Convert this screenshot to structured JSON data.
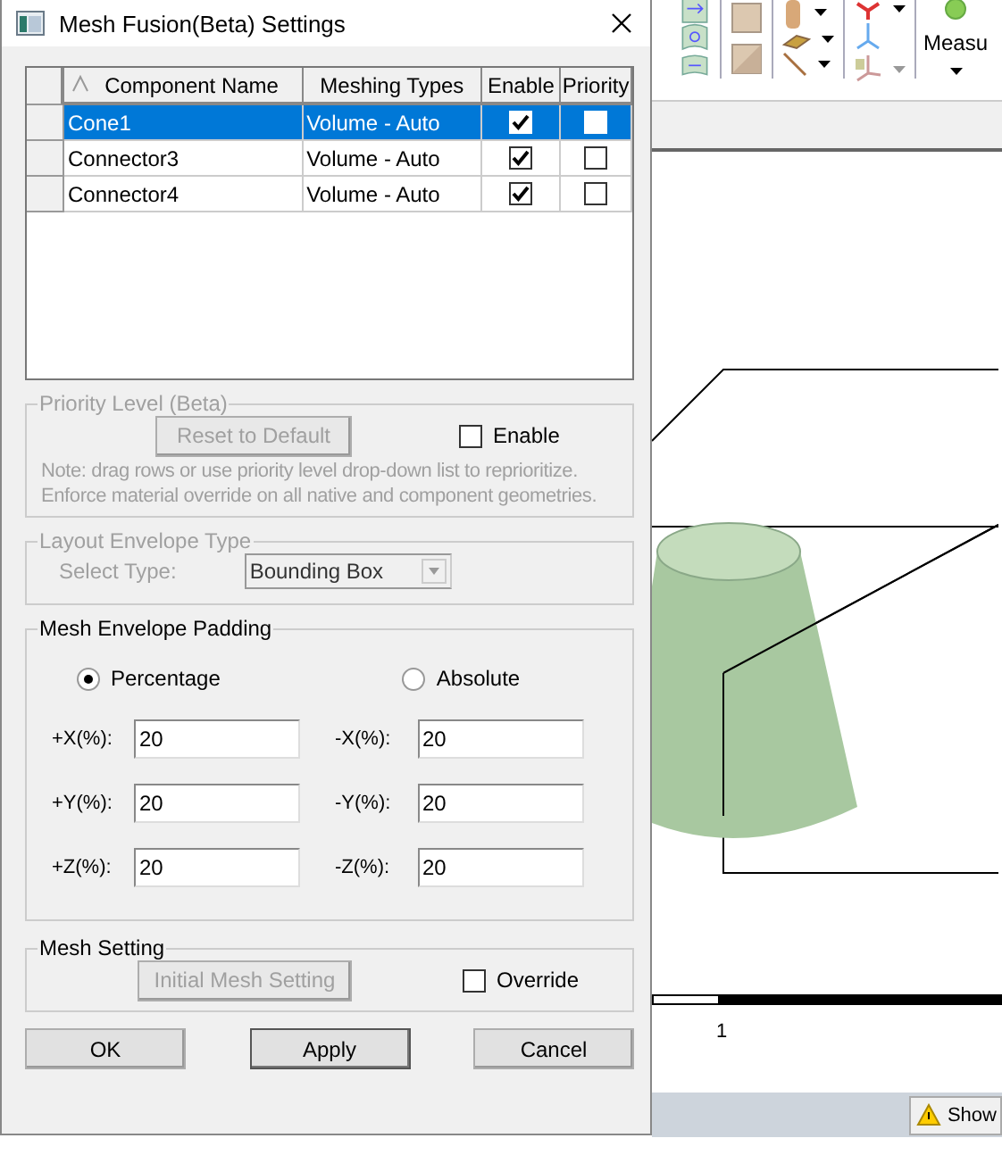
{
  "window": {
    "title": "Mesh Fusion(Beta) Settings"
  },
  "table": {
    "columns": [
      "Component Name",
      "Meshing Types",
      "Enable",
      "Priority"
    ],
    "rows": [
      {
        "name": "Cone1",
        "meshing_type": "Volume - Auto",
        "enable": true,
        "priority": false,
        "selected": true
      },
      {
        "name": "Connector3",
        "meshing_type": "Volume - Auto",
        "enable": true,
        "priority": false,
        "selected": false
      },
      {
        "name": "Connector4",
        "meshing_type": "Volume - Auto",
        "enable": true,
        "priority": false,
        "selected": false
      }
    ]
  },
  "priority_level": {
    "title": "Priority Level (Beta)",
    "disabled": true,
    "button": "Reset to Default",
    "checkbox": {
      "label": "Enable",
      "checked": false
    },
    "note_lines": [
      "Note: drag rows or use priority level drop-down list to reprioritize.",
      "Enforce material override on all native and component geometries."
    ]
  },
  "layout_envelope": {
    "title": "Layout Envelope Type",
    "disabled": true,
    "label": "Select Type:",
    "value": "Bounding Box"
  },
  "padding": {
    "title": "Mesh Envelope Padding",
    "radios": [
      {
        "label": "Percentage",
        "selected": true
      },
      {
        "label": "Absolute",
        "selected": false
      }
    ],
    "fields": [
      {
        "label": "+X(%):",
        "value": "20"
      },
      {
        "label": "-X(%):",
        "value": "20"
      },
      {
        "label": "+Y(%):",
        "value": "20"
      },
      {
        "label": "-Y(%):",
        "value": "20"
      },
      {
        "label": "+Z(%):",
        "value": "20"
      },
      {
        "label": "-Z(%):",
        "value": "20"
      }
    ]
  },
  "mesh_setting": {
    "title": "Mesh Setting",
    "button": "Initial Mesh Setting",
    "button_disabled": true,
    "checkbox": {
      "label": "Override",
      "checked": false
    }
  },
  "buttons": [
    "OK",
    "Apply",
    "Cancel"
  ],
  "background": {
    "measure_label": "Measu",
    "scale_label": "1",
    "status_button": "Show"
  }
}
